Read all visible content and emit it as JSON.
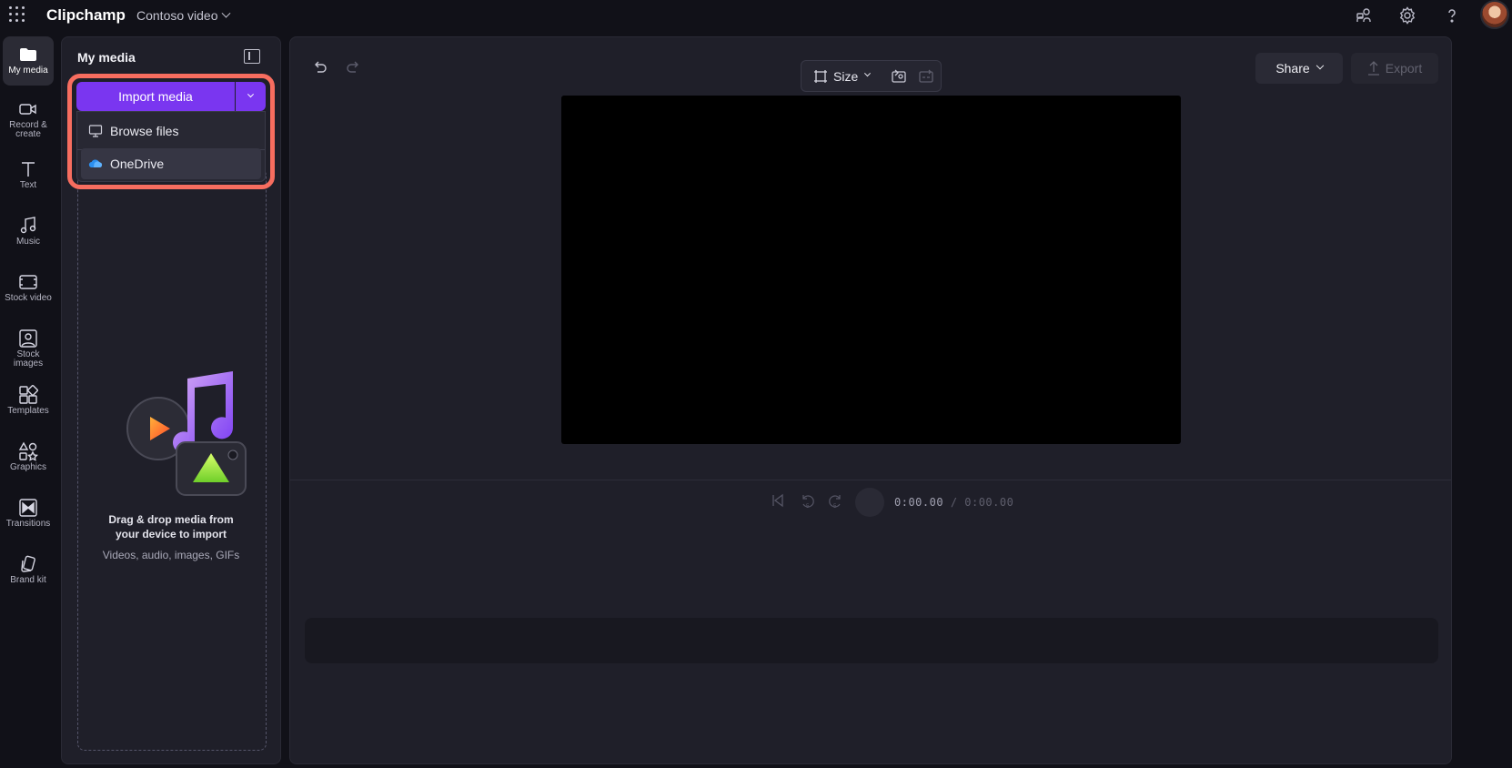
{
  "topbar": {
    "brand": "Clipchamp",
    "project_name": "Contoso video",
    "icons": [
      "people-icon",
      "gear-icon",
      "help-icon"
    ]
  },
  "rail": {
    "items": [
      {
        "label": "My media",
        "icon": "folder-icon",
        "active": true
      },
      {
        "label": "Record & create",
        "icon": "camera-icon"
      },
      {
        "label": "Text",
        "icon": "text-icon"
      },
      {
        "label": "Music",
        "icon": "music-icon"
      },
      {
        "label": "Stock video",
        "icon": "film-icon"
      },
      {
        "label": "Stock images",
        "icon": "image-icon"
      },
      {
        "label": "Templates",
        "icon": "templates-icon"
      },
      {
        "label": "Graphics",
        "icon": "shapes-icon"
      },
      {
        "label": "Transitions",
        "icon": "transition-icon"
      },
      {
        "label": "Brand kit",
        "icon": "brand-kit-icon"
      }
    ]
  },
  "panel": {
    "title": "My media",
    "import_label": "Import media",
    "menu": {
      "browse_files": "Browse files",
      "onedrive": "OneDrive"
    },
    "drop_title": "Drag & drop media from your device to import",
    "drop_subtitle": "Videos, audio, images, GIFs"
  },
  "main": {
    "size_label": "Size",
    "share_label": "Share",
    "export_label": "Export",
    "time_current": "0:00.00",
    "time_total": "/ 0:00.00",
    "colors": {
      "accent": "#7a36f0",
      "highlight": "#f76d5f",
      "preview": "#000000"
    }
  }
}
